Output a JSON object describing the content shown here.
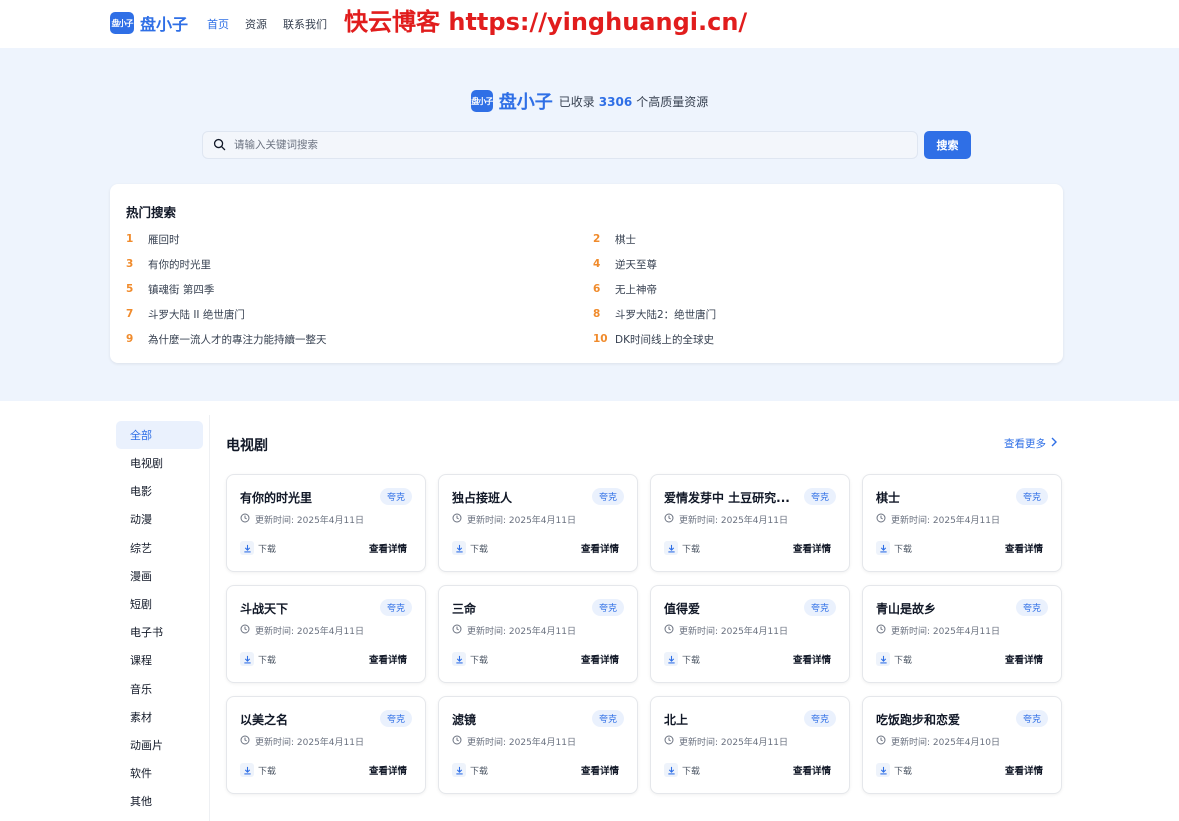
{
  "header": {
    "logo_mark": "盘小子",
    "logo_text": "盘小子",
    "nav": [
      "首页",
      "资源",
      "联系我们"
    ],
    "watermark": "快云博客 https://yinghuangi.cn/"
  },
  "hero": {
    "logo_mark": "盘小子",
    "logo_text": "盘小子",
    "prefix": "已收录",
    "count": "3306",
    "suffix": "个高质量资源",
    "search_placeholder": "请输入关键词搜索",
    "search_button": "搜索"
  },
  "hot": {
    "title": "热门搜索",
    "items": [
      {
        "rank": "1",
        "text": "雁回时"
      },
      {
        "rank": "2",
        "text": "棋士"
      },
      {
        "rank": "3",
        "text": "有你的时光里"
      },
      {
        "rank": "4",
        "text": "逆天至尊"
      },
      {
        "rank": "5",
        "text": "镇魂街 第四季"
      },
      {
        "rank": "6",
        "text": "无上神帝"
      },
      {
        "rank": "7",
        "text": "斗罗大陆 II 绝世唐门"
      },
      {
        "rank": "8",
        "text": "斗罗大陆2：绝世唐门"
      },
      {
        "rank": "9",
        "text": "為什麼一流人才的專注力能持續一整天"
      },
      {
        "rank": "10",
        "text": "DK时间线上的全球史"
      }
    ]
  },
  "sidebar": {
    "items": [
      "全部",
      "电视剧",
      "电影",
      "动漫",
      "综艺",
      "漫画",
      "短剧",
      "电子书",
      "课程",
      "音乐",
      "素材",
      "动画片",
      "软件",
      "其他"
    ]
  },
  "main": {
    "title": "电视剧",
    "more": "查看更多",
    "cards": [
      {
        "title": "有你的时光里",
        "tag": "夸克",
        "time": "更新时间: 2025年4月11日",
        "download": "下载",
        "detail": "查看详情"
      },
      {
        "title": "独占接班人",
        "tag": "夸克",
        "time": "更新时间: 2025年4月11日",
        "download": "下载",
        "detail": "查看详情"
      },
      {
        "title": "爱情发芽中 土豆研究...",
        "tag": "夸克",
        "time": "更新时间: 2025年4月11日",
        "download": "下载",
        "detail": "查看详情"
      },
      {
        "title": "棋士",
        "tag": "夸克",
        "time": "更新时间: 2025年4月11日",
        "download": "下载",
        "detail": "查看详情"
      },
      {
        "title": "斗战天下",
        "tag": "夸克",
        "time": "更新时间: 2025年4月11日",
        "download": "下载",
        "detail": "查看详情"
      },
      {
        "title": "三命",
        "tag": "夸克",
        "time": "更新时间: 2025年4月11日",
        "download": "下载",
        "detail": "查看详情"
      },
      {
        "title": "值得爱",
        "tag": "夸克",
        "time": "更新时间: 2025年4月11日",
        "download": "下载",
        "detail": "查看详情"
      },
      {
        "title": "青山是故乡",
        "tag": "夸克",
        "time": "更新时间: 2025年4月11日",
        "download": "下载",
        "detail": "查看详情"
      },
      {
        "title": "以美之名",
        "tag": "夸克",
        "time": "更新时间: 2025年4月11日",
        "download": "下载",
        "detail": "查看详情"
      },
      {
        "title": "滤镜",
        "tag": "夸克",
        "time": "更新时间: 2025年4月11日",
        "download": "下载",
        "detail": "查看详情"
      },
      {
        "title": "北上",
        "tag": "夸克",
        "time": "更新时间: 2025年4月11日",
        "download": "下载",
        "detail": "查看详情"
      },
      {
        "title": "吃饭跑步和恋爱",
        "tag": "夸克",
        "time": "更新时间: 2025年4月10日",
        "download": "下载",
        "detail": "查看详情"
      }
    ]
  },
  "colors": {
    "accent": "#2f6fe6",
    "hero_bg": "#eef4fd",
    "rank": "#f08b2c",
    "watermark": "#e11d1d"
  }
}
